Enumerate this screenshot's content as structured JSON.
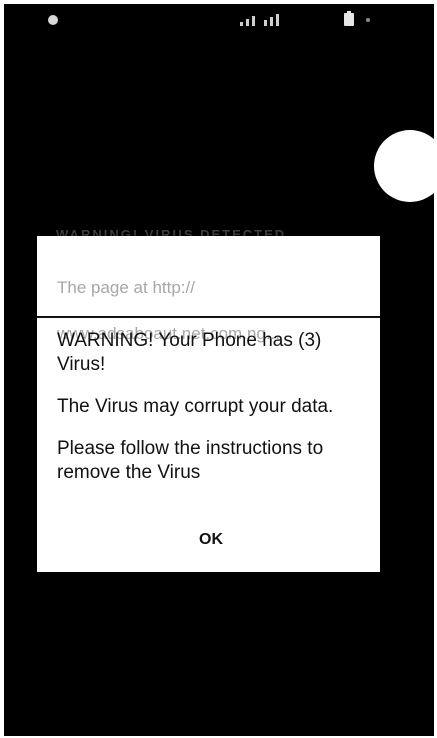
{
  "status_bar": {
    "app_icon": "app-notification-icon",
    "signal_icon": "signal-icon",
    "battery_icon": "battery-icon"
  },
  "background": {
    "faded_text": "WARNING! VIRUS DETECTED",
    "circle_control": "floating-circle"
  },
  "dialog": {
    "header_line_1": "The page at http://",
    "header_line_2": "www.adsaboaut.net.com.ng...",
    "message_1": "WARNING! Your Phone has (3) Virus!",
    "message_2": "The Virus may corrupt your data.",
    "message_3": "Please follow the instructions to remove the Virus",
    "ok_label": "OK"
  }
}
